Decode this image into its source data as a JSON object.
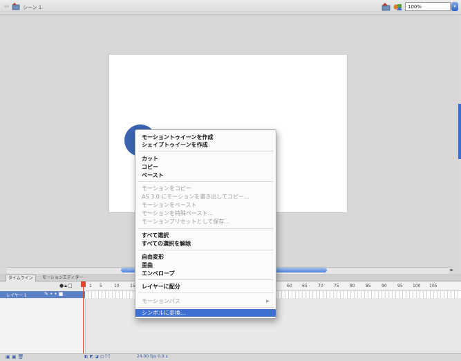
{
  "header": {
    "scene_label": "シーン 1",
    "zoom_value": "100%"
  },
  "timeline": {
    "tabs": [
      "タイムライン",
      "モーションエディター"
    ],
    "ruler_ticks": [
      "1",
      "5",
      "10",
      "15",
      "60",
      "65",
      "70",
      "75",
      "80",
      "85",
      "90",
      "95",
      "100",
      "105"
    ],
    "layer_name": "レイヤー 1",
    "fps": "24.00 fps",
    "time": "0.0 s"
  },
  "context_menu": {
    "items": [
      {
        "label": "モーショントゥイーンを作成",
        "enabled": true,
        "group": 1
      },
      {
        "label": "シェイプトゥイーンを作成",
        "enabled": true,
        "group": 1
      },
      {
        "label": "カット",
        "enabled": true,
        "group": 2
      },
      {
        "label": "コピー",
        "enabled": true,
        "group": 2
      },
      {
        "label": "ペースト",
        "enabled": true,
        "group": 2
      },
      {
        "label": "モーションをコピー",
        "enabled": false,
        "group": 3
      },
      {
        "label": "AS 3.0 にモーションを書き出してコピー...",
        "enabled": false,
        "group": 3
      },
      {
        "label": "モーションをペースト",
        "enabled": false,
        "group": 3
      },
      {
        "label": "モーションを特殊ペースト...",
        "enabled": false,
        "group": 3
      },
      {
        "label": "モーションプリセットとして保存...",
        "enabled": false,
        "group": 3
      },
      {
        "label": "すべて選択",
        "enabled": true,
        "group": 4
      },
      {
        "label": "すべての選択を解除",
        "enabled": true,
        "group": 4
      },
      {
        "label": "自由変形",
        "enabled": true,
        "group": 5
      },
      {
        "label": "歪曲",
        "enabled": true,
        "group": 5
      },
      {
        "label": "エンベロープ",
        "enabled": true,
        "group": 5
      },
      {
        "label": "レイヤーに配分",
        "enabled": true,
        "group": 6
      },
      {
        "label": "モーションパス",
        "enabled": false,
        "group": 7
      },
      {
        "label": "シンボルに変換...",
        "enabled": true,
        "group": 8,
        "highlighted": true
      }
    ]
  },
  "colors": {
    "highlight": "#3f6fd0",
    "circle": "#3c64b0",
    "playhead": "#d54a2b"
  }
}
